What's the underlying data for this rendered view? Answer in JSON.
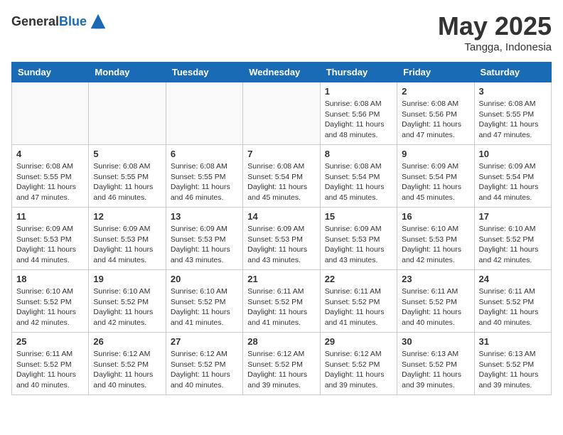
{
  "header": {
    "logo_general": "General",
    "logo_blue": "Blue",
    "month": "May 2025",
    "location": "Tangga, Indonesia"
  },
  "weekdays": [
    "Sunday",
    "Monday",
    "Tuesday",
    "Wednesday",
    "Thursday",
    "Friday",
    "Saturday"
  ],
  "weeks": [
    [
      {
        "day": "",
        "info": ""
      },
      {
        "day": "",
        "info": ""
      },
      {
        "day": "",
        "info": ""
      },
      {
        "day": "",
        "info": ""
      },
      {
        "day": "1",
        "sunrise": "6:08 AM",
        "sunset": "5:56 PM",
        "daylight": "11 hours and 48 minutes."
      },
      {
        "day": "2",
        "sunrise": "6:08 AM",
        "sunset": "5:56 PM",
        "daylight": "11 hours and 47 minutes."
      },
      {
        "day": "3",
        "sunrise": "6:08 AM",
        "sunset": "5:55 PM",
        "daylight": "11 hours and 47 minutes."
      }
    ],
    [
      {
        "day": "4",
        "sunrise": "6:08 AM",
        "sunset": "5:55 PM",
        "daylight": "11 hours and 47 minutes."
      },
      {
        "day": "5",
        "sunrise": "6:08 AM",
        "sunset": "5:55 PM",
        "daylight": "11 hours and 46 minutes."
      },
      {
        "day": "6",
        "sunrise": "6:08 AM",
        "sunset": "5:55 PM",
        "daylight": "11 hours and 46 minutes."
      },
      {
        "day": "7",
        "sunrise": "6:08 AM",
        "sunset": "5:54 PM",
        "daylight": "11 hours and 45 minutes."
      },
      {
        "day": "8",
        "sunrise": "6:08 AM",
        "sunset": "5:54 PM",
        "daylight": "11 hours and 45 minutes."
      },
      {
        "day": "9",
        "sunrise": "6:09 AM",
        "sunset": "5:54 PM",
        "daylight": "11 hours and 45 minutes."
      },
      {
        "day": "10",
        "sunrise": "6:09 AM",
        "sunset": "5:54 PM",
        "daylight": "11 hours and 44 minutes."
      }
    ],
    [
      {
        "day": "11",
        "sunrise": "6:09 AM",
        "sunset": "5:53 PM",
        "daylight": "11 hours and 44 minutes."
      },
      {
        "day": "12",
        "sunrise": "6:09 AM",
        "sunset": "5:53 PM",
        "daylight": "11 hours and 44 minutes."
      },
      {
        "day": "13",
        "sunrise": "6:09 AM",
        "sunset": "5:53 PM",
        "daylight": "11 hours and 43 minutes."
      },
      {
        "day": "14",
        "sunrise": "6:09 AM",
        "sunset": "5:53 PM",
        "daylight": "11 hours and 43 minutes."
      },
      {
        "day": "15",
        "sunrise": "6:09 AM",
        "sunset": "5:53 PM",
        "daylight": "11 hours and 43 minutes."
      },
      {
        "day": "16",
        "sunrise": "6:10 AM",
        "sunset": "5:53 PM",
        "daylight": "11 hours and 42 minutes."
      },
      {
        "day": "17",
        "sunrise": "6:10 AM",
        "sunset": "5:52 PM",
        "daylight": "11 hours and 42 minutes."
      }
    ],
    [
      {
        "day": "18",
        "sunrise": "6:10 AM",
        "sunset": "5:52 PM",
        "daylight": "11 hours and 42 minutes."
      },
      {
        "day": "19",
        "sunrise": "6:10 AM",
        "sunset": "5:52 PM",
        "daylight": "11 hours and 42 minutes."
      },
      {
        "day": "20",
        "sunrise": "6:10 AM",
        "sunset": "5:52 PM",
        "daylight": "11 hours and 41 minutes."
      },
      {
        "day": "21",
        "sunrise": "6:11 AM",
        "sunset": "5:52 PM",
        "daylight": "11 hours and 41 minutes."
      },
      {
        "day": "22",
        "sunrise": "6:11 AM",
        "sunset": "5:52 PM",
        "daylight": "11 hours and 41 minutes."
      },
      {
        "day": "23",
        "sunrise": "6:11 AM",
        "sunset": "5:52 PM",
        "daylight": "11 hours and 40 minutes."
      },
      {
        "day": "24",
        "sunrise": "6:11 AM",
        "sunset": "5:52 PM",
        "daylight": "11 hours and 40 minutes."
      }
    ],
    [
      {
        "day": "25",
        "sunrise": "6:11 AM",
        "sunset": "5:52 PM",
        "daylight": "11 hours and 40 minutes."
      },
      {
        "day": "26",
        "sunrise": "6:12 AM",
        "sunset": "5:52 PM",
        "daylight": "11 hours and 40 minutes."
      },
      {
        "day": "27",
        "sunrise": "6:12 AM",
        "sunset": "5:52 PM",
        "daylight": "11 hours and 40 minutes."
      },
      {
        "day": "28",
        "sunrise": "6:12 AM",
        "sunset": "5:52 PM",
        "daylight": "11 hours and 39 minutes."
      },
      {
        "day": "29",
        "sunrise": "6:12 AM",
        "sunset": "5:52 PM",
        "daylight": "11 hours and 39 minutes."
      },
      {
        "day": "30",
        "sunrise": "6:13 AM",
        "sunset": "5:52 PM",
        "daylight": "11 hours and 39 minutes."
      },
      {
        "day": "31",
        "sunrise": "6:13 AM",
        "sunset": "5:52 PM",
        "daylight": "11 hours and 39 minutes."
      }
    ]
  ],
  "labels": {
    "sunrise": "Sunrise:",
    "sunset": "Sunset:",
    "daylight": "Daylight:"
  }
}
